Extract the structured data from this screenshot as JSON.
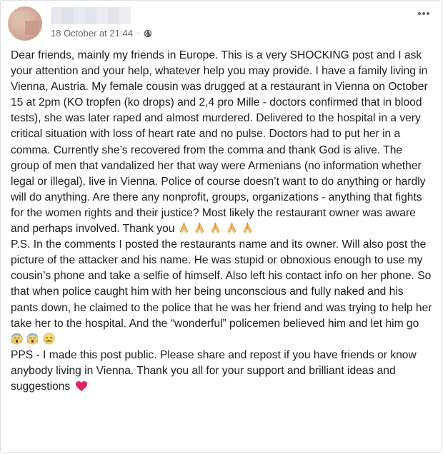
{
  "post": {
    "author_name": "",
    "timestamp": "18 October at 21:44",
    "privacy_icon": "globe-icon",
    "menu_icon": "more-options-icon",
    "paragraphs": {
      "main": "Dear friends, mainly my friends in Europe. This is a very SHOCKING post and I ask your attention and your help, whatever help you may provide. I have a family living in Vienna, Austria. My female cousin was drugged at a restaurant in Vienna on October 15 at 2pm (KO tropfen (ko drops) and 2,4 pro Mille - doctors confirmed that in blood tests), she was later raped and almost murdered. Delivered to the hospital in a very critical situation with loss of heart rate and no pulse. Doctors had to put her in a comma. Currently she’s recovered from the comma and thank God is alive. The group of men that vandalized her that way were Armenians (no information whether legal or illegal), live in Vienna. Police of course doesn’t want to do anything or hardly will do anything. Are there any nonprofit, groups, organizations - anything that fights for the women rights and their justice? Most likely the restaurant owner was aware and perhaps involved. Thank you",
      "ps": "P.S. In the comments I posted the restaurants name and its owner. Will also post the picture of the attacker and his name. He was stupid or obnoxious enough to use my cousin’s phone and take a selfie of himself. Also left his contact info on her phone. So that when police caught him with her being unconscious and fully naked and his pants down, he claimed to the police that he was her friend and was trying to help her take her to the hospital. And the “wonderful” policemen believed him and let him go",
      "pps": "PPS - I made this post public. Please share and repost if you have friends or know anybody living in Vienna. Thank you all for your support and brilliant ideas and suggestions"
    },
    "emoji": {
      "main_end": [
        "folded-hands-icon",
        "folded-hands-icon",
        "folded-hands-icon",
        "folded-hands-icon",
        "folded-hands-icon"
      ],
      "ps_end": [
        "face-screaming-icon",
        "face-screaming-icon",
        "crying-face-icon"
      ],
      "pps_end": [
        "red-heart-icon"
      ]
    },
    "colors": {
      "text": "#1c1e21",
      "meta": "#616770",
      "border": "#dddfe2",
      "heart": "#e0245e"
    }
  }
}
